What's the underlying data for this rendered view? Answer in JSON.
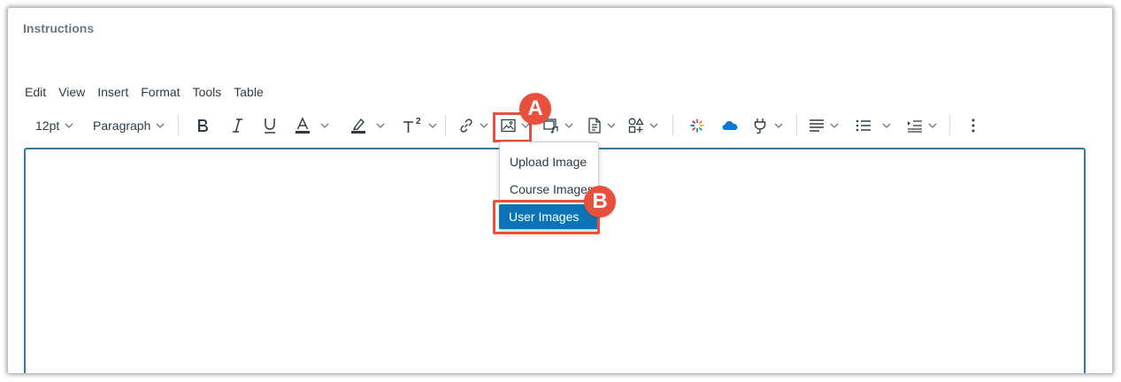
{
  "section": {
    "title": "Instructions"
  },
  "menubar": {
    "items": [
      "Edit",
      "View",
      "Insert",
      "Format",
      "Tools",
      "Table"
    ]
  },
  "toolbar": {
    "font_size": "12pt",
    "block_format": "Paragraph",
    "superscript_mark": "2",
    "icons": [
      "bold-icon",
      "italic-icon",
      "underline-icon",
      "text-color-icon",
      "highlight-icon",
      "superscript-icon",
      "link-icon",
      "image-icon",
      "media-icon",
      "document-icon",
      "shapes-icon",
      "apps-icon",
      "onedrive-icon",
      "plugin-icon",
      "align-icon",
      "list-icon",
      "indent-icon",
      "more-options-icon"
    ]
  },
  "image_menu": {
    "items": [
      "Upload Image",
      "Course Images",
      "User Images"
    ],
    "selected": "User Images"
  },
  "callouts": {
    "a": "A",
    "b": "B"
  },
  "colors": {
    "accent": "#e9503c",
    "selection": "#0b74b4",
    "editor_border": "#2b7ea1",
    "text": "#2d3b45",
    "onedrive": "#0a78d4"
  }
}
